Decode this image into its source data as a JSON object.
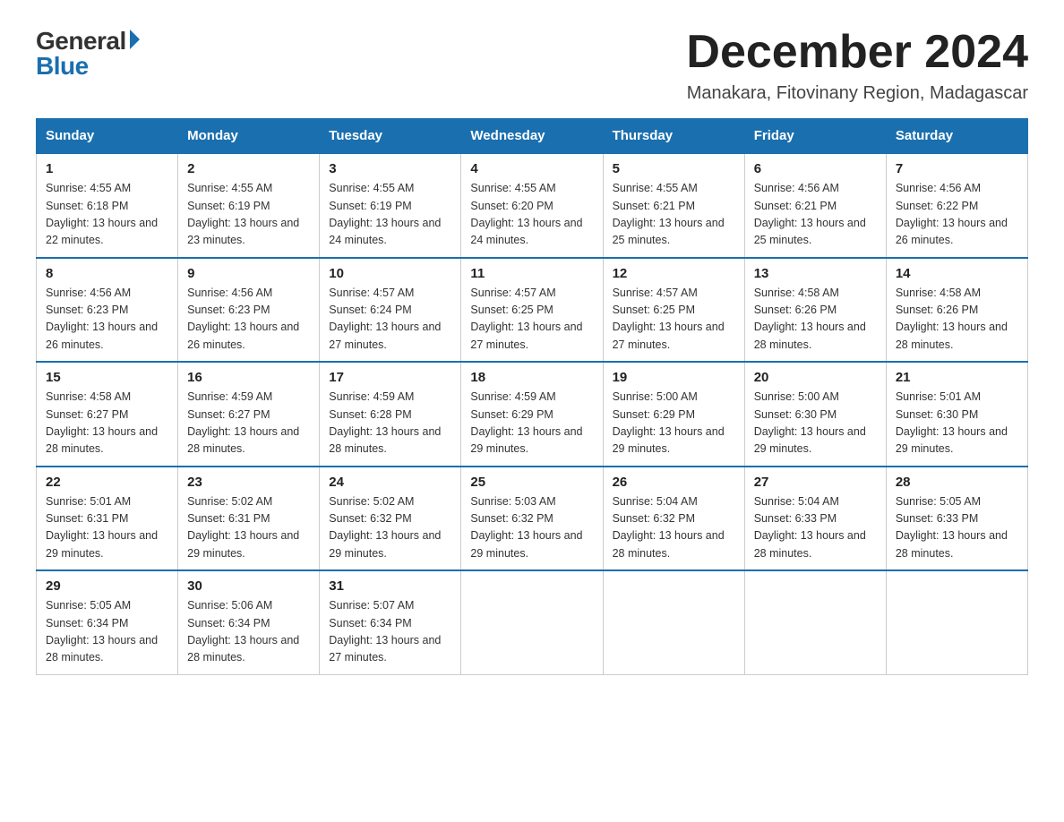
{
  "logo": {
    "general": "General",
    "blue": "Blue"
  },
  "title": "December 2024",
  "subtitle": "Manakara, Fitovinany Region, Madagascar",
  "days_of_week": [
    "Sunday",
    "Monday",
    "Tuesday",
    "Wednesday",
    "Thursday",
    "Friday",
    "Saturday"
  ],
  "weeks": [
    [
      {
        "day": "1",
        "sunrise": "4:55 AM",
        "sunset": "6:18 PM",
        "daylight": "13 hours and 22 minutes."
      },
      {
        "day": "2",
        "sunrise": "4:55 AM",
        "sunset": "6:19 PM",
        "daylight": "13 hours and 23 minutes."
      },
      {
        "day": "3",
        "sunrise": "4:55 AM",
        "sunset": "6:19 PM",
        "daylight": "13 hours and 24 minutes."
      },
      {
        "day": "4",
        "sunrise": "4:55 AM",
        "sunset": "6:20 PM",
        "daylight": "13 hours and 24 minutes."
      },
      {
        "day": "5",
        "sunrise": "4:55 AM",
        "sunset": "6:21 PM",
        "daylight": "13 hours and 25 minutes."
      },
      {
        "day": "6",
        "sunrise": "4:56 AM",
        "sunset": "6:21 PM",
        "daylight": "13 hours and 25 minutes."
      },
      {
        "day": "7",
        "sunrise": "4:56 AM",
        "sunset": "6:22 PM",
        "daylight": "13 hours and 26 minutes."
      }
    ],
    [
      {
        "day": "8",
        "sunrise": "4:56 AM",
        "sunset": "6:23 PM",
        "daylight": "13 hours and 26 minutes."
      },
      {
        "day": "9",
        "sunrise": "4:56 AM",
        "sunset": "6:23 PM",
        "daylight": "13 hours and 26 minutes."
      },
      {
        "day": "10",
        "sunrise": "4:57 AM",
        "sunset": "6:24 PM",
        "daylight": "13 hours and 27 minutes."
      },
      {
        "day": "11",
        "sunrise": "4:57 AM",
        "sunset": "6:25 PM",
        "daylight": "13 hours and 27 minutes."
      },
      {
        "day": "12",
        "sunrise": "4:57 AM",
        "sunset": "6:25 PM",
        "daylight": "13 hours and 27 minutes."
      },
      {
        "day": "13",
        "sunrise": "4:58 AM",
        "sunset": "6:26 PM",
        "daylight": "13 hours and 28 minutes."
      },
      {
        "day": "14",
        "sunrise": "4:58 AM",
        "sunset": "6:26 PM",
        "daylight": "13 hours and 28 minutes."
      }
    ],
    [
      {
        "day": "15",
        "sunrise": "4:58 AM",
        "sunset": "6:27 PM",
        "daylight": "13 hours and 28 minutes."
      },
      {
        "day": "16",
        "sunrise": "4:59 AM",
        "sunset": "6:27 PM",
        "daylight": "13 hours and 28 minutes."
      },
      {
        "day": "17",
        "sunrise": "4:59 AM",
        "sunset": "6:28 PM",
        "daylight": "13 hours and 28 minutes."
      },
      {
        "day": "18",
        "sunrise": "4:59 AM",
        "sunset": "6:29 PM",
        "daylight": "13 hours and 29 minutes."
      },
      {
        "day": "19",
        "sunrise": "5:00 AM",
        "sunset": "6:29 PM",
        "daylight": "13 hours and 29 minutes."
      },
      {
        "day": "20",
        "sunrise": "5:00 AM",
        "sunset": "6:30 PM",
        "daylight": "13 hours and 29 minutes."
      },
      {
        "day": "21",
        "sunrise": "5:01 AM",
        "sunset": "6:30 PM",
        "daylight": "13 hours and 29 minutes."
      }
    ],
    [
      {
        "day": "22",
        "sunrise": "5:01 AM",
        "sunset": "6:31 PM",
        "daylight": "13 hours and 29 minutes."
      },
      {
        "day": "23",
        "sunrise": "5:02 AM",
        "sunset": "6:31 PM",
        "daylight": "13 hours and 29 minutes."
      },
      {
        "day": "24",
        "sunrise": "5:02 AM",
        "sunset": "6:32 PM",
        "daylight": "13 hours and 29 minutes."
      },
      {
        "day": "25",
        "sunrise": "5:03 AM",
        "sunset": "6:32 PM",
        "daylight": "13 hours and 29 minutes."
      },
      {
        "day": "26",
        "sunrise": "5:04 AM",
        "sunset": "6:32 PM",
        "daylight": "13 hours and 28 minutes."
      },
      {
        "day": "27",
        "sunrise": "5:04 AM",
        "sunset": "6:33 PM",
        "daylight": "13 hours and 28 minutes."
      },
      {
        "day": "28",
        "sunrise": "5:05 AM",
        "sunset": "6:33 PM",
        "daylight": "13 hours and 28 minutes."
      }
    ],
    [
      {
        "day": "29",
        "sunrise": "5:05 AM",
        "sunset": "6:34 PM",
        "daylight": "13 hours and 28 minutes."
      },
      {
        "day": "30",
        "sunrise": "5:06 AM",
        "sunset": "6:34 PM",
        "daylight": "13 hours and 28 minutes."
      },
      {
        "day": "31",
        "sunrise": "5:07 AM",
        "sunset": "6:34 PM",
        "daylight": "13 hours and 27 minutes."
      },
      null,
      null,
      null,
      null
    ]
  ]
}
